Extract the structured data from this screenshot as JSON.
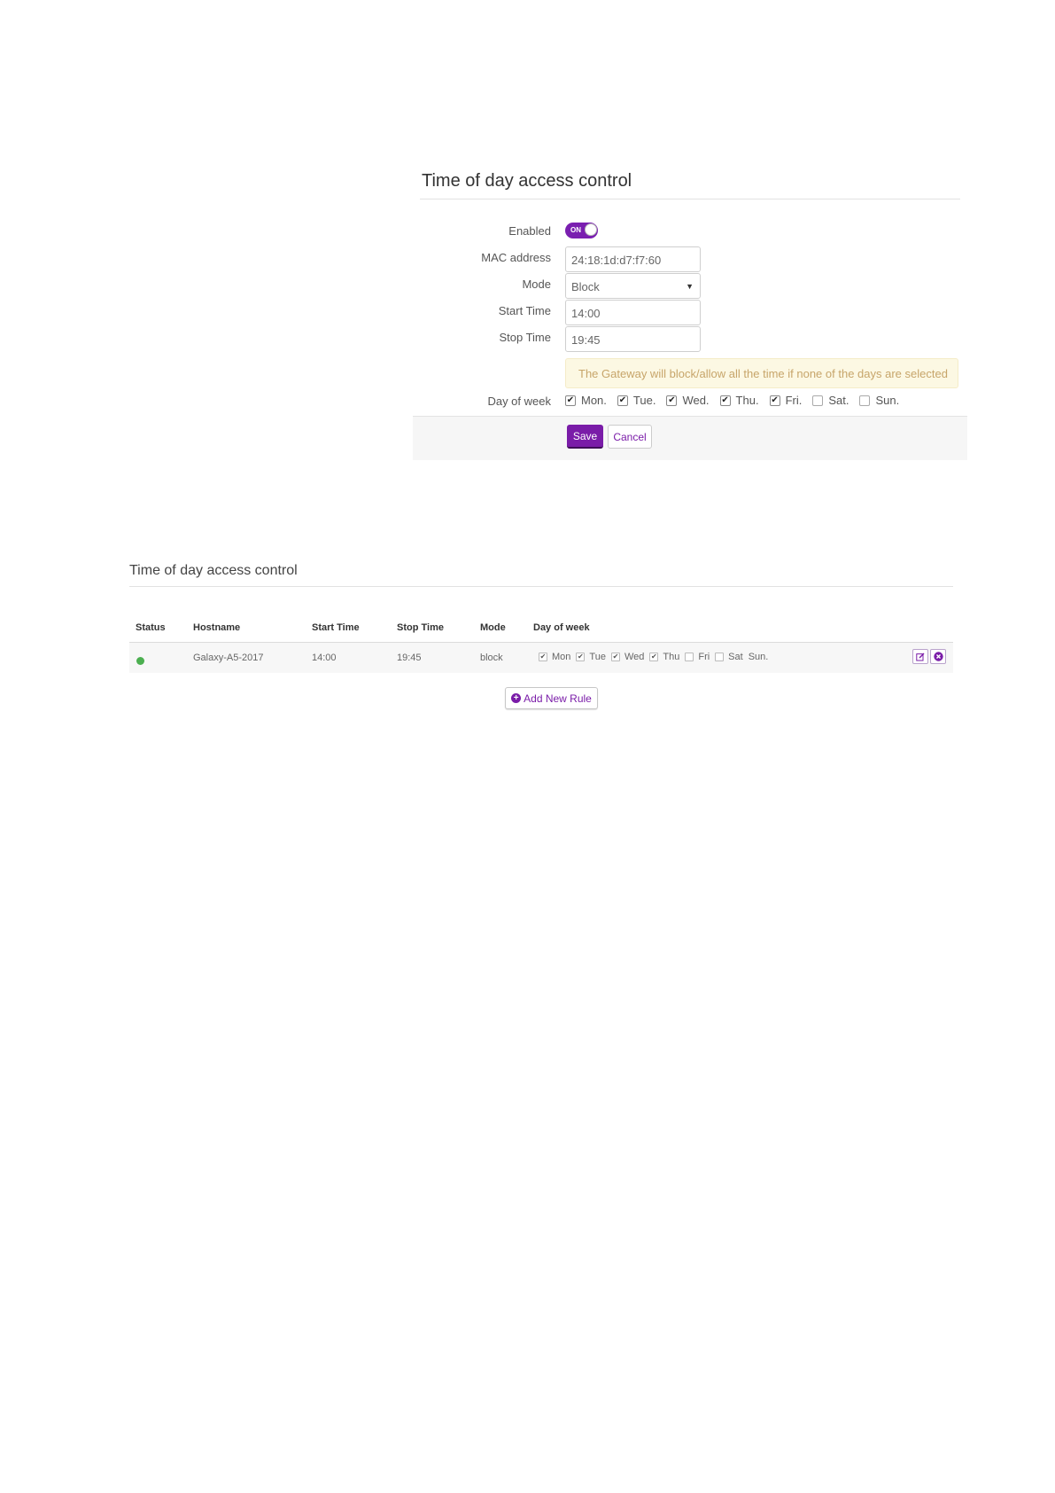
{
  "form": {
    "title": "Time of day access control",
    "labels": {
      "enabled": "Enabled",
      "mac_address": "MAC address",
      "mode": "Mode",
      "start_time": "Start Time",
      "stop_time": "Stop Time",
      "day_of_week": "Day of week"
    },
    "enabled_toggle": {
      "text": "ON",
      "state": true
    },
    "mac_address_value": "24:18:1d:d7:f7:60",
    "mode_value": "Block",
    "start_time_value": "14:00",
    "stop_time_value": "19:45",
    "notice": "The Gateway will block/allow all the time if none of the days are selected",
    "days": [
      {
        "label": "Mon.",
        "checked": true
      },
      {
        "label": "Tue.",
        "checked": true
      },
      {
        "label": "Wed.",
        "checked": true
      },
      {
        "label": "Thu.",
        "checked": true
      },
      {
        "label": "Fri.",
        "checked": true
      },
      {
        "label": "Sat.",
        "checked": false
      },
      {
        "label": "Sun.",
        "checked": false
      }
    ],
    "save_label": "Save",
    "cancel_label": "Cancel"
  },
  "rules_list": {
    "title": "Time of day access control",
    "headers": [
      "Status",
      "Hostname",
      "Start Time",
      "Stop Time",
      "Mode",
      "Day of week"
    ],
    "rows": [
      {
        "status": "active",
        "hostname": "Galaxy-A5-2017",
        "start_time": "14:00",
        "stop_time": "19:45",
        "mode": "block",
        "days": [
          {
            "label": "Mon",
            "checked": true
          },
          {
            "label": "Tue",
            "checked": true
          },
          {
            "label": "Wed",
            "checked": true
          },
          {
            "label": "Thu",
            "checked": true
          },
          {
            "label": "Fri",
            "checked": false
          },
          {
            "label": "Sat",
            "checked": false
          },
          {
            "label": "Sun.",
            "checked": null
          }
        ]
      }
    ],
    "add_rule_label": "Add New Rule"
  },
  "colors": {
    "accent": "#7a1ca8",
    "status_active": "#4caf50",
    "notice_bg": "#fcf8e3",
    "notice_text": "#c7a56a"
  },
  "icons": [
    "chevron-down-icon",
    "edit-icon",
    "delete-icon",
    "plus-circle-icon"
  ]
}
